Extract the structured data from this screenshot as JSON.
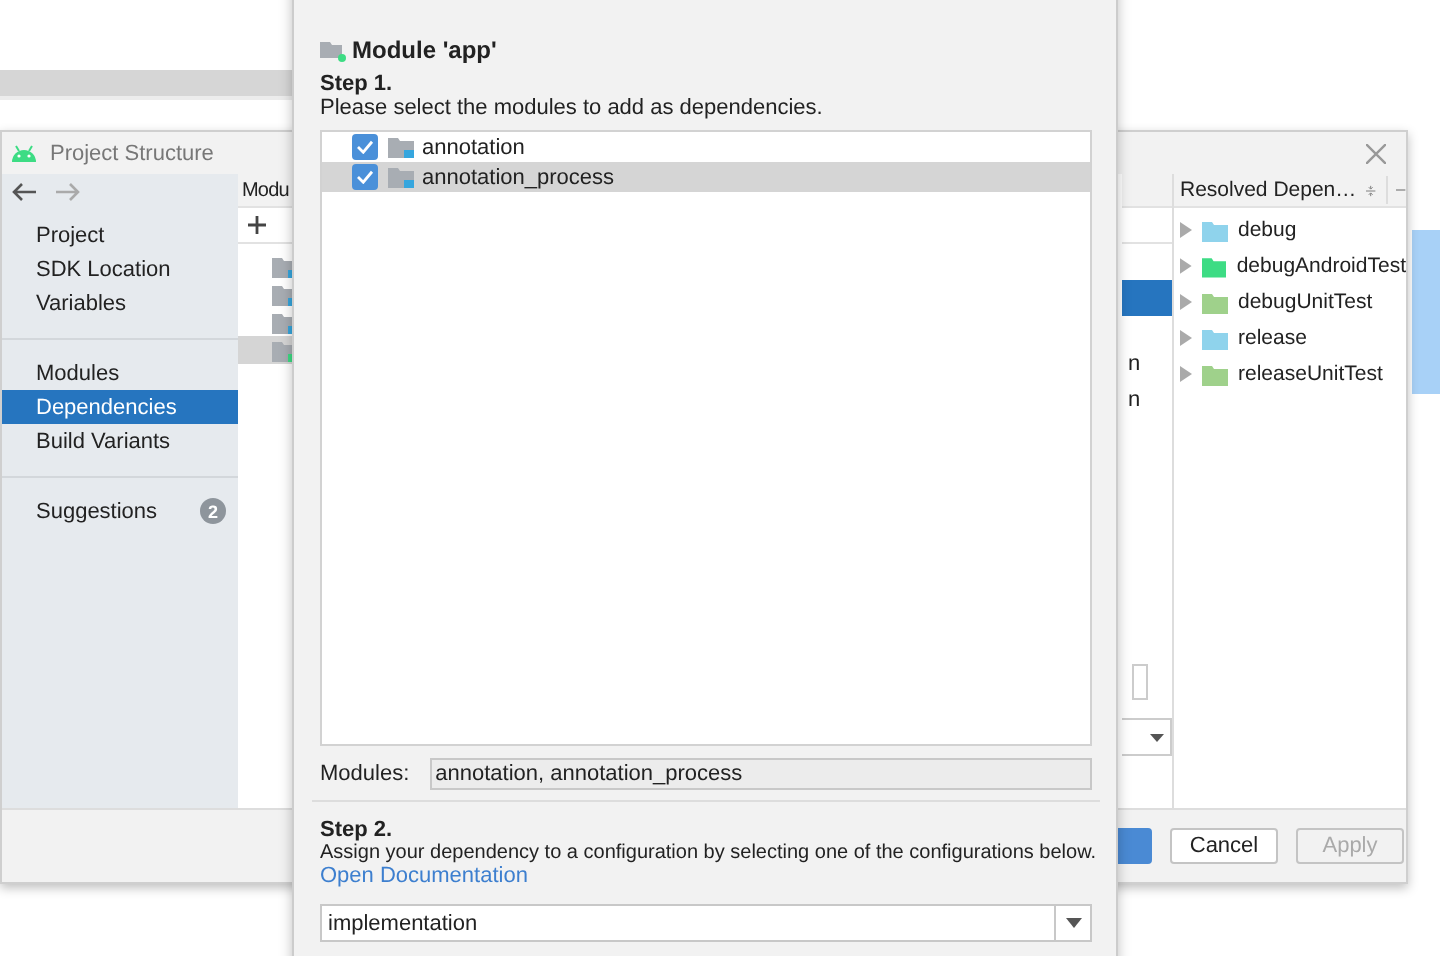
{
  "project_structure": {
    "title": "Project Structure",
    "sidebar": {
      "sections": [
        {
          "items": [
            {
              "label": "Project",
              "selected": false
            },
            {
              "label": "SDK Location",
              "selected": false
            },
            {
              "label": "Variables",
              "selected": false
            }
          ]
        },
        {
          "items": [
            {
              "label": "Modules",
              "selected": false
            },
            {
              "label": "Dependencies",
              "selected": true
            },
            {
              "label": "Build Variants",
              "selected": false
            }
          ]
        },
        {
          "items": [
            {
              "label": "Suggestions",
              "selected": false,
              "badge": "2"
            }
          ]
        }
      ]
    },
    "modules_panel": {
      "header": "Modu",
      "items": [
        {
          "selected": false
        },
        {
          "selected": false
        },
        {
          "selected": false
        },
        {
          "selected": true
        }
      ]
    },
    "detail_fragments": [
      "n",
      "n"
    ],
    "resolved_panel": {
      "title": "Resolved Depen…",
      "items": [
        {
          "label": "debug",
          "color": "#8fd3ec"
        },
        {
          "label": "debugAndroidTest",
          "color": "#3ddc84"
        },
        {
          "label": "debugUnitTest",
          "color": "#9fd18b"
        },
        {
          "label": "release",
          "color": "#8fd3ec"
        },
        {
          "label": "releaseUnitTest",
          "color": "#9fd18b"
        }
      ]
    },
    "buttons": [
      {
        "kind": "primary",
        "disabled": false
      },
      {
        "kind": "plain",
        "label": "Cancel",
        "disabled": false
      },
      {
        "kind": "plain",
        "label": "Apply",
        "disabled": true
      }
    ]
  },
  "dialog": {
    "module": "Module 'app'",
    "step1": {
      "heading": "Step 1.",
      "text": "Please select the modules to add as dependencies."
    },
    "modules": [
      {
        "label": "annotation",
        "checked": true,
        "selected": false
      },
      {
        "label": "annotation_process",
        "checked": true,
        "selected": true
      }
    ],
    "modules_field": {
      "label": "Modules:",
      "value": "annotation, annotation_process"
    },
    "step2": {
      "heading": "Step 2.",
      "text": "Assign your dependency to a configuration by selecting one of the configurations below.",
      "link": "Open Documentation"
    },
    "configuration": {
      "value": "implementation"
    }
  }
}
